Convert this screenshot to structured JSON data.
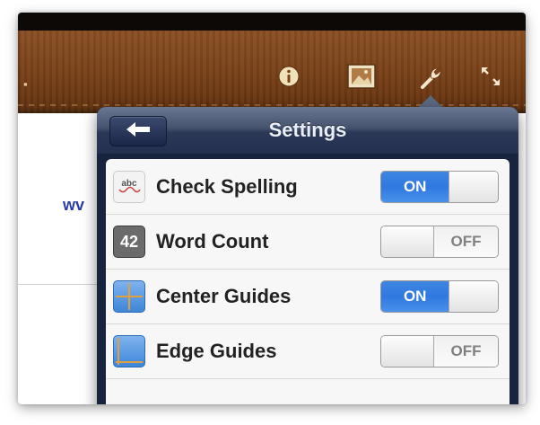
{
  "toolbar": {
    "icons": [
      "info-icon",
      "image-icon",
      "wrench-icon",
      "expand-icon"
    ]
  },
  "document": {
    "visible_text": "wv"
  },
  "settings": {
    "title": "Settings",
    "back_icon": "left-arrow-icon",
    "rows": [
      {
        "label": "Check Spelling",
        "icon_text": "abc",
        "state": "ON"
      },
      {
        "label": "Word Count",
        "icon_text": "42",
        "state": "OFF"
      },
      {
        "label": "Center Guides",
        "icon_text": "",
        "state": "ON"
      },
      {
        "label": "Edge Guides",
        "icon_text": "",
        "state": "OFF"
      }
    ]
  },
  "colors": {
    "switch_on": "#2f78e0",
    "header": "#2b3856",
    "toolbar_wood": "#7a4219"
  }
}
